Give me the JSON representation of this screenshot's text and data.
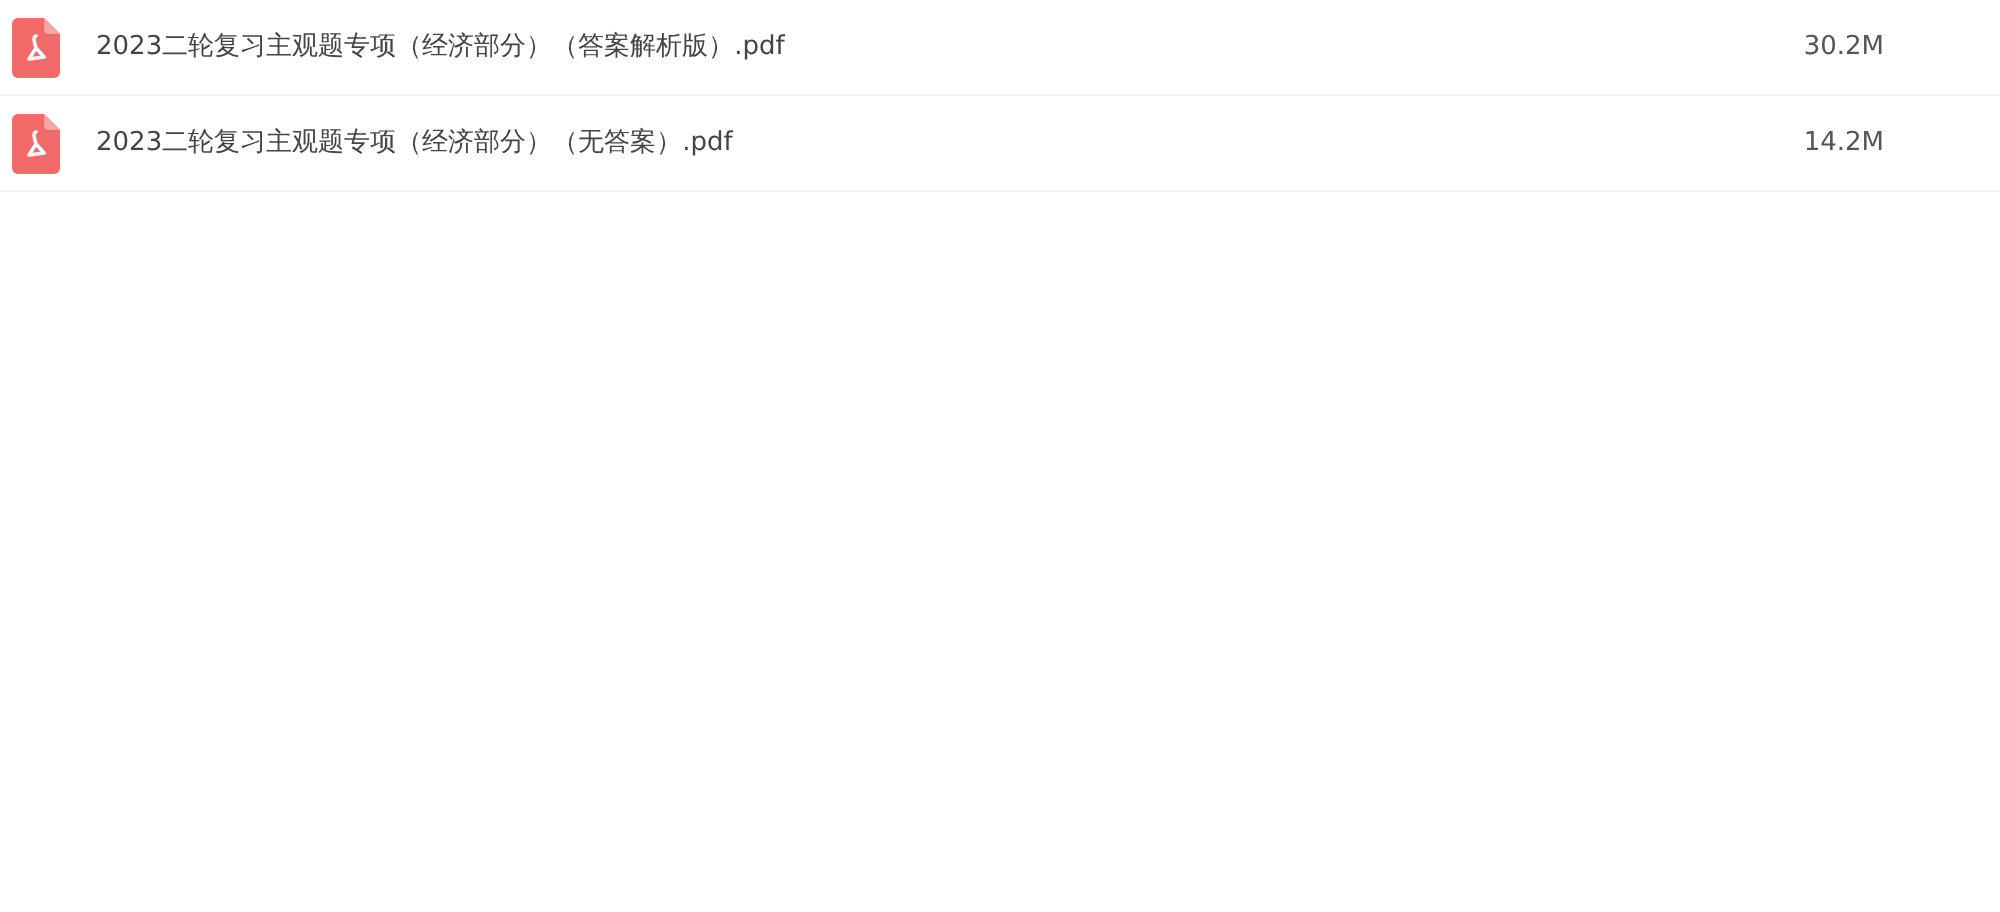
{
  "files": [
    {
      "kind": "pdf",
      "name": "2023二轮复习主观题专项（经济部分）（答案解析版）.pdf",
      "size": "30.2M"
    },
    {
      "kind": "pdf",
      "name": "2023二轮复习主观题专项（经济部分）（无答案）.pdf",
      "size": "14.2M"
    }
  ]
}
